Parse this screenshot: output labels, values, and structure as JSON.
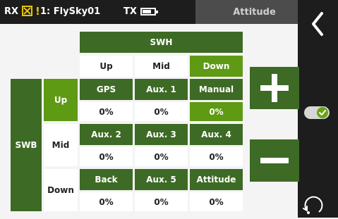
{
  "status": {
    "rx_label": "RX",
    "warn_symbol": "!",
    "model": "1: FlySky01",
    "tx_label": "TX",
    "tx_battery_level": 0.75,
    "page_title": "Attitude"
  },
  "table": {
    "col_switch": "SWH",
    "col_positions": [
      "Up",
      "Mid",
      "Down"
    ],
    "row_switch": "SWB",
    "row_positions": [
      "Up",
      "Mid",
      "Down"
    ],
    "rows": [
      {
        "modes": [
          "GPS",
          "Aux. 1",
          "Manual"
        ],
        "values": [
          "0%",
          "0%",
          "0%"
        ]
      },
      {
        "modes": [
          "Aux. 2",
          "Aux. 3",
          "Aux. 4"
        ],
        "values": [
          "0%",
          "0%",
          "0%"
        ]
      },
      {
        "modes": [
          "Back",
          "Aux. 5",
          "Attitude"
        ],
        "values": [
          "0%",
          "0%",
          "0%"
        ]
      }
    ]
  },
  "icons": {
    "back": "chevron-left-icon",
    "toggle": "toggle-check-icon",
    "refresh": "refresh-icon",
    "plus": "plus-icon",
    "minus": "minus-icon"
  },
  "colors": {
    "header_green": "#3d6a24",
    "active_green": "#5e9a14",
    "warning_yellow": "#e8c400",
    "dark_bar": "#1d1d1d"
  }
}
